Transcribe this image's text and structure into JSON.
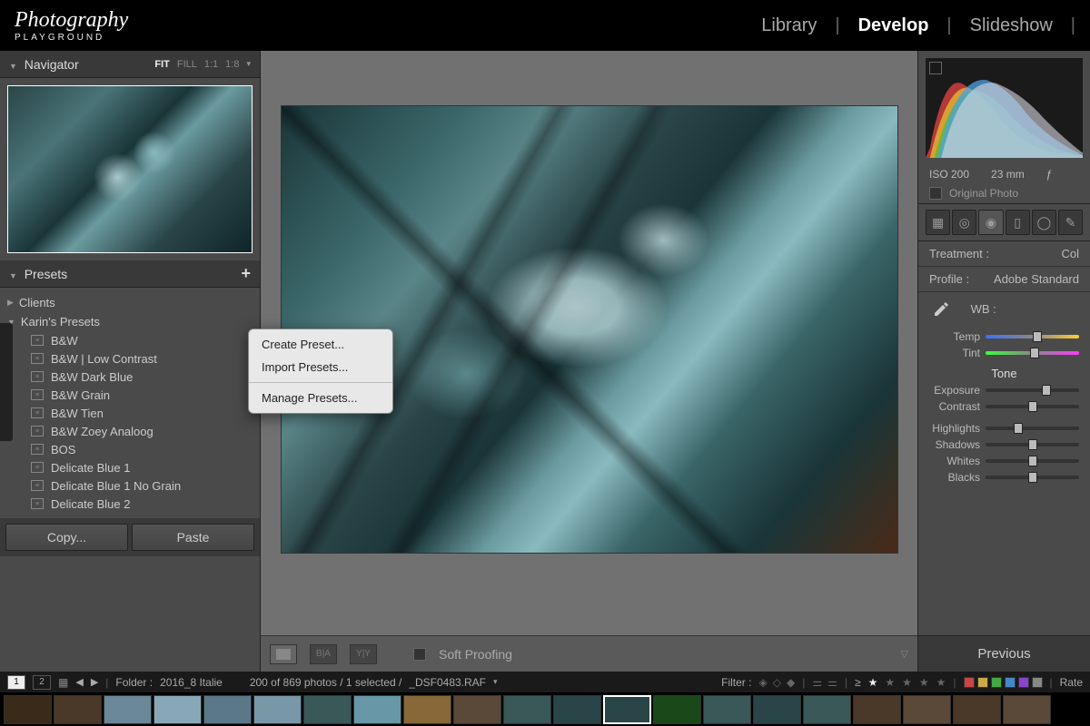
{
  "logo": {
    "main": "Photography",
    "sub": "PLAYGROUND"
  },
  "modules": {
    "library": "Library",
    "develop": "Develop",
    "slideshow": "Slideshow"
  },
  "navigator": {
    "title": "Navigator",
    "ratios": [
      "FIT",
      "FILL",
      "1:1",
      "1:8"
    ]
  },
  "presets": {
    "title": "Presets",
    "folders": [
      {
        "name": "Clients",
        "expanded": false
      },
      {
        "name": "Karin's Presets",
        "expanded": true,
        "items": [
          "B&W",
          "B&W | Low Contrast",
          "B&W Dark Blue",
          "B&W Grain",
          "B&W Tien",
          "B&W Zoey Analoog",
          "BOS",
          "Delicate Blue 1",
          "Delicate Blue 1 No Grain",
          "Delicate Blue 2"
        ]
      }
    ],
    "context": [
      "Create Preset...",
      "Import Presets...",
      "Manage Presets..."
    ]
  },
  "left_buttons": {
    "copy": "Copy...",
    "paste": "Paste"
  },
  "center_bottom": {
    "soft_proofing": "Soft Proofing"
  },
  "histogram": {
    "iso": "ISO 200",
    "focal": "23 mm",
    "aperture": "ƒ",
    "original": "Original Photo"
  },
  "treatment": {
    "label": "Treatment :",
    "value": "Col"
  },
  "profile": {
    "label": "Profile :",
    "value": "Adobe Standard"
  },
  "wb": {
    "label": "WB :",
    "temp": "Temp",
    "tint": "Tint"
  },
  "tone": {
    "label": "Tone",
    "exposure": "Exposure",
    "contrast": "Contrast",
    "highlights": "Highlights",
    "shadows": "Shadows",
    "whites": "Whites",
    "blacks": "Blacks"
  },
  "right_bottom": {
    "previous": "Previous"
  },
  "status": {
    "pages": [
      "1",
      "2"
    ],
    "folder_label": "Folder :",
    "folder": "2016_8 Italie",
    "count": "200 of 869 photos / 1 selected /",
    "filename": "_DSF0483.RAF",
    "filter_label": "Filter :",
    "gte": "≥",
    "rate": "Rate"
  },
  "colors": {
    "chips": [
      "#c44",
      "#ca4",
      "#4a4",
      "#48c",
      "#84c",
      "#888"
    ]
  },
  "film": {
    "count": 21,
    "selected": 12,
    "bg": [
      "#3a2a1a",
      "#4a3828",
      "#6a8898",
      "#88a8b8",
      "#5a7888",
      "#7898a8",
      "#3a5858",
      "#6898a8",
      "#886838",
      "#5a4838",
      "#3a5858",
      "#2a4548",
      "#2a4548",
      "#1a4818",
      "#3a5858",
      "#2a4548",
      "#3a5858",
      "#4a3828",
      "#5a4838",
      "#4a3828",
      "#5a4838"
    ]
  }
}
